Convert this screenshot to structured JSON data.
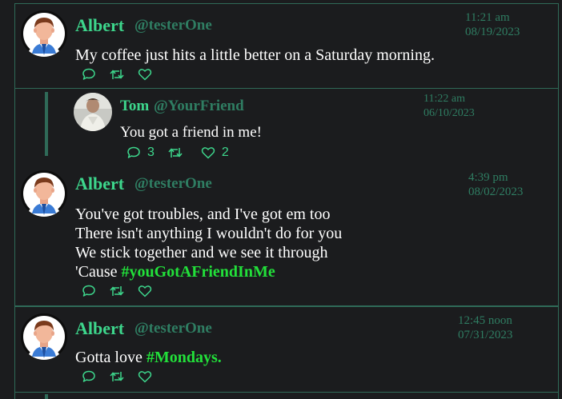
{
  "colors": {
    "background": "#1b1c1e",
    "border": "#2f6a58",
    "name": "#3dd68c",
    "handle": "#2f7d62",
    "hashtag": "#22e03a",
    "text": "#ffffff"
  },
  "posts": [
    {
      "name": "Albert",
      "handle": "@testerOne",
      "time": "11:21 am",
      "date": "08/19/2023",
      "lines": [
        "My coffee just hits a little better on a Saturday morning."
      ],
      "avatar": "cartoon-man-avatar"
    },
    {
      "name": "Tom",
      "handle": "@YourFriend",
      "time": "11:22 am",
      "date": "06/10/2023",
      "lines": [
        "You got a friend in me!"
      ],
      "comments": "3",
      "likes": "2",
      "avatar": "photo-avatar"
    },
    {
      "name": "Albert",
      "handle": "@testerOne",
      "time": "4:39 pm",
      "date": "08/02/2023",
      "lines": [
        "You've got troubles, and I've got em too",
        "There isn't anything I wouldn't do for you",
        "We stick together and we see it through",
        "'Cause "
      ],
      "hashtag": "#youGotAFriendInMe",
      "avatar": "cartoon-man-avatar"
    },
    {
      "name": "Albert",
      "handle": "@testerOne",
      "time": "12:45 noon",
      "date": "07/31/2023",
      "text_prefix": "Gotta love ",
      "hashtag": "#Mondays.",
      "avatar": "cartoon-man-avatar"
    }
  ]
}
